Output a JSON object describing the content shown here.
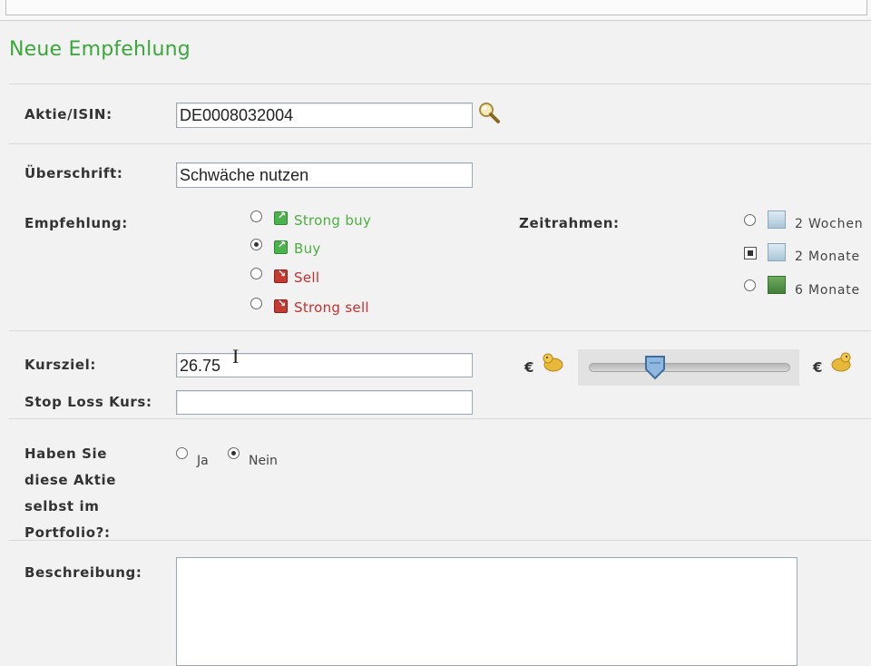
{
  "section": {
    "title": "Neue Empfehlung"
  },
  "form": {
    "isin_label": "Aktie/ISIN:",
    "isin_value": "DE0008032004",
    "headline_label": "Überschrift:",
    "headline_value": "Schwäche nutzen",
    "recommendation_label": "Empfehlung:",
    "recommendations": [
      {
        "label": "Strong buy",
        "selected": false,
        "color": "#4caf3f"
      },
      {
        "label": "Buy",
        "selected": true,
        "color": "#4caf3f"
      },
      {
        "label": "Sell",
        "selected": false,
        "color": "#c9302c"
      },
      {
        "label": "Strong sell",
        "selected": false,
        "color": "#c9302c"
      }
    ],
    "timeframe_label": "Zeitrahmen:",
    "timeframes": [
      {
        "label": "2 Wochen",
        "selected": false,
        "icon": "calendar-icon"
      },
      {
        "label": "2 Monate",
        "selected": true,
        "icon": "calendar-icon"
      },
      {
        "label": "6 Monate",
        "selected": false,
        "icon": "landscape-icon"
      }
    ],
    "target_label": "Kursziel:",
    "target_value": "26.75",
    "stoploss_label": "Stop Loss Kurs:",
    "stoploss_value": "",
    "currency_symbol": "€",
    "slider_position_fraction": 0.33,
    "portfolio_label_lines": [
      "Haben Sie",
      "diese Aktie",
      "selbst im",
      "Portfolio?:"
    ],
    "portfolio_options": [
      {
        "label": "Ja",
        "selected": false
      },
      {
        "label": "Nein",
        "selected": true
      }
    ],
    "description_label": "Beschreibung:",
    "description_value": ""
  },
  "colors": {
    "title_green": "#3aa83a",
    "buy_green": "#4caf3f",
    "sell_red": "#c9302c"
  }
}
